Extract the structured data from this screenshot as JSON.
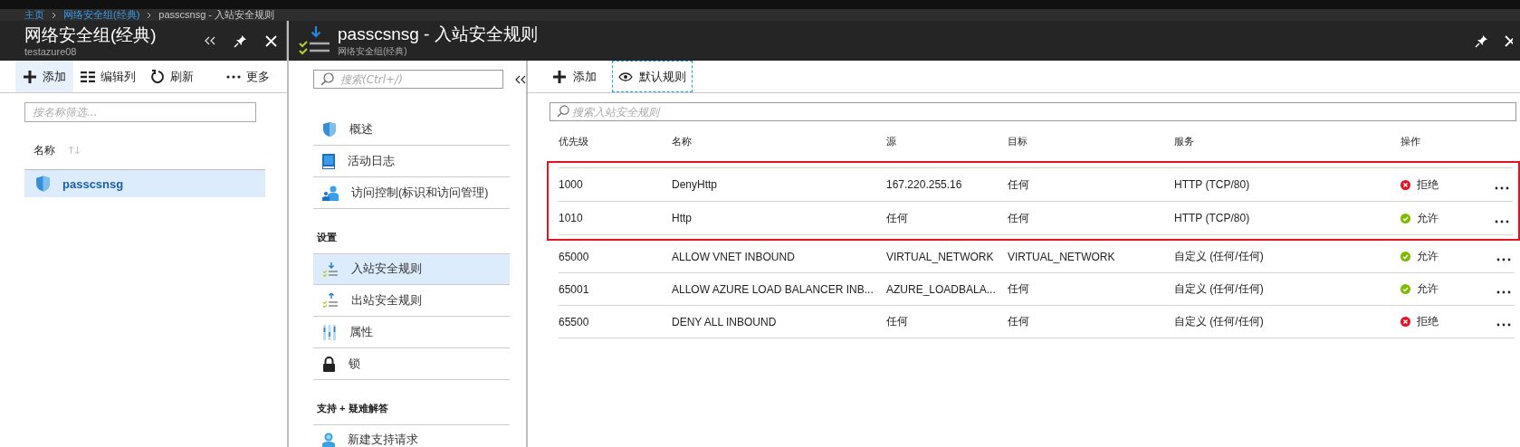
{
  "breadcrumb": [
    {
      "label": "主页",
      "link": true
    },
    {
      "label": "网络安全组(经典)",
      "link": true
    },
    {
      "label": "passcsnsg - 入站安全规则",
      "link": false
    }
  ],
  "left_blade": {
    "title": "网络安全组(经典)",
    "subtitle": "testazure08",
    "toolbar": [
      {
        "label": "添加",
        "selected": true
      },
      {
        "label": "编辑列",
        "selected": false
      },
      {
        "label": "刷新",
        "selected": false
      },
      {
        "label": "更多",
        "selected": false
      }
    ],
    "filter": {
      "placeholder": "按名称筛选..."
    },
    "column": "名称",
    "items": [
      {
        "name": "passcsnsg",
        "selected": true
      }
    ]
  },
  "blade": {
    "title": "passcsnsg - 入站安全规则",
    "subtitle": "网络安全组(经典)"
  },
  "menu": {
    "search": {
      "placeholder": "搜索(Ctrl+/)"
    },
    "sections": [
      {
        "items": [
          {
            "label": "概述",
            "selected": false
          },
          {
            "label": "活动日志",
            "selected": false
          },
          {
            "label": "访问控制(标识和访问管理)",
            "selected": false
          }
        ]
      },
      {
        "heading": "设置",
        "items": [
          {
            "label": "入站安全规则",
            "selected": true
          },
          {
            "label": "出站安全规则",
            "selected": false
          },
          {
            "label": "属性",
            "selected": false
          },
          {
            "label": "锁",
            "selected": false
          }
        ]
      },
      {
        "heading": "支持 + 疑难解答",
        "items": [
          {
            "label": "新建支持请求",
            "selected": false
          }
        ]
      }
    ]
  },
  "content": {
    "toolbar": [
      {
        "label": "添加",
        "focused": false
      },
      {
        "label": "默认规则",
        "focused": true
      }
    ],
    "search": {
      "placeholder": "搜索入站安全规则"
    },
    "table": {
      "columns": [
        "优先级",
        "名称",
        "源",
        "目标",
        "服务",
        "操作"
      ],
      "rows": [
        {
          "priority": "1000",
          "name": "DenyHttp",
          "source": "167.220.255.16",
          "destination": "任何",
          "service": "HTTP (TCP/80)",
          "action": "拒绝",
          "kind": "deny",
          "highlighted": true
        },
        {
          "priority": "1010",
          "name": "Http",
          "source": "任何",
          "destination": "任何",
          "service": "HTTP (TCP/80)",
          "action": "允许",
          "kind": "allow",
          "highlighted": true
        },
        {
          "priority": "65000",
          "name": "ALLOW VNET INBOUND",
          "source": "VIRTUAL_NETWORK",
          "destination": "VIRTUAL_NETWORK",
          "service": "自定义 (任何/任何)",
          "action": "允许",
          "kind": "allow",
          "highlighted": false
        },
        {
          "priority": "65001",
          "name": "ALLOW AZURE LOAD BALANCER INB...",
          "source": "AZURE_LOADBALA...",
          "destination": "任何",
          "service": "自定义 (任何/任何)",
          "action": "允许",
          "kind": "allow",
          "highlighted": false
        },
        {
          "priority": "65500",
          "name": "DENY ALL INBOUND",
          "source": "任何",
          "destination": "任何",
          "service": "自定义 (任何/任何)",
          "action": "拒绝",
          "kind": "deny",
          "highlighted": false
        }
      ]
    }
  }
}
